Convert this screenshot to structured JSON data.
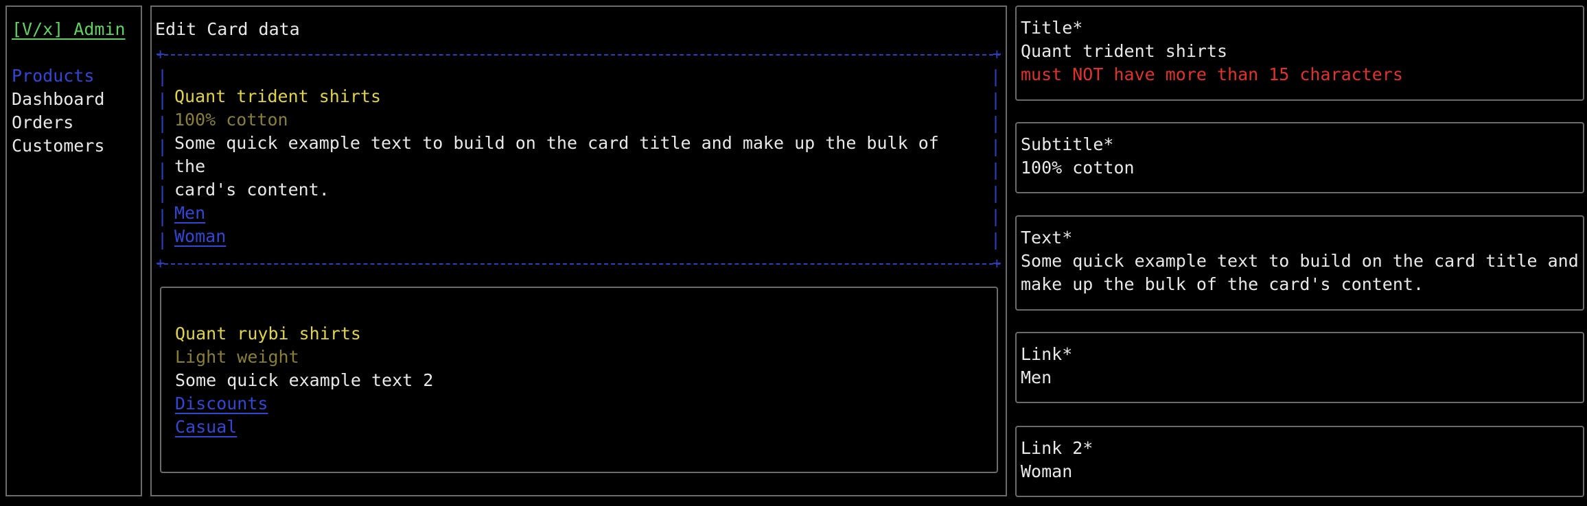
{
  "sidebar": {
    "brand": "[V/x] Admin",
    "items": [
      {
        "label": "Products",
        "active": true
      },
      {
        "label": "Dashboard"
      },
      {
        "label": "Orders"
      },
      {
        "label": "Customers"
      }
    ]
  },
  "main": {
    "heading": "Edit Card data",
    "cards": [
      {
        "title": "Quant trident shirts",
        "subtitle": "100% cotton",
        "text_line1": "Some quick example text to build on the card title and make up the bulk of the",
        "text_line2": "card's content.",
        "link1": "Men",
        "link2": "Woman"
      },
      {
        "title": "Quant ruybi shirts",
        "subtitle": "Light weight",
        "text": "Some quick example text 2",
        "link1": "Discounts",
        "link2": "Casual"
      }
    ]
  },
  "form": {
    "title": {
      "label": "Title*",
      "value": "Quant trident shirts",
      "error": "must NOT have more than 15 characters"
    },
    "subtitle": {
      "label": "Subtitle*",
      "value": "100% cotton"
    },
    "text": {
      "label": "Text*",
      "value_line1": "Some quick example text to build on the card title and",
      "value_line2": "make up the bulk of the card's content."
    },
    "link": {
      "label": "Link*",
      "value": "Men"
    },
    "link2": {
      "label": "Link 2*",
      "value": "Woman"
    }
  },
  "colors": {
    "brand": "#5fd35f",
    "active_nav": "#3346d6",
    "card_title": "#e0d348",
    "card_subtitle": "#8a7f36",
    "link": "#3346d6",
    "error": "#e0322b",
    "selection_border": "#2a3fc2"
  }
}
